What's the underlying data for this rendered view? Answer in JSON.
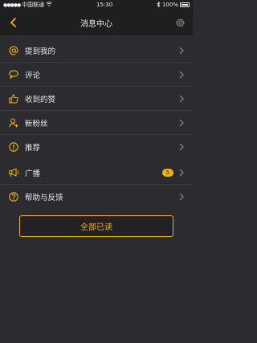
{
  "status_bar": {
    "carrier": "中国联通",
    "time": "15:30",
    "battery": "100%"
  },
  "nav": {
    "title": "消息中心",
    "back_icon": "chevron-left-icon",
    "settings_icon": "gear-icon"
  },
  "messages": [
    {
      "label": "提到我的",
      "icon": "at-icon"
    },
    {
      "label": "评论",
      "icon": "comment-bubble-icon"
    },
    {
      "label": "收到的赞",
      "icon": "thumbs-up-icon"
    },
    {
      "label": "新粉丝",
      "icon": "add-user-icon"
    },
    {
      "label": "推荐",
      "icon": "exclamation-circle-icon"
    }
  ],
  "others": [
    {
      "label": "广播",
      "icon": "megaphone-icon",
      "badge": "5"
    },
    {
      "label": "帮助与反馈",
      "icon": "question-circle-icon"
    }
  ],
  "actions": {
    "mark_all_read": "全部已读"
  },
  "colors": {
    "accent": "#f0b400",
    "background": "#2c2c30",
    "bar": "#1f1f22"
  }
}
